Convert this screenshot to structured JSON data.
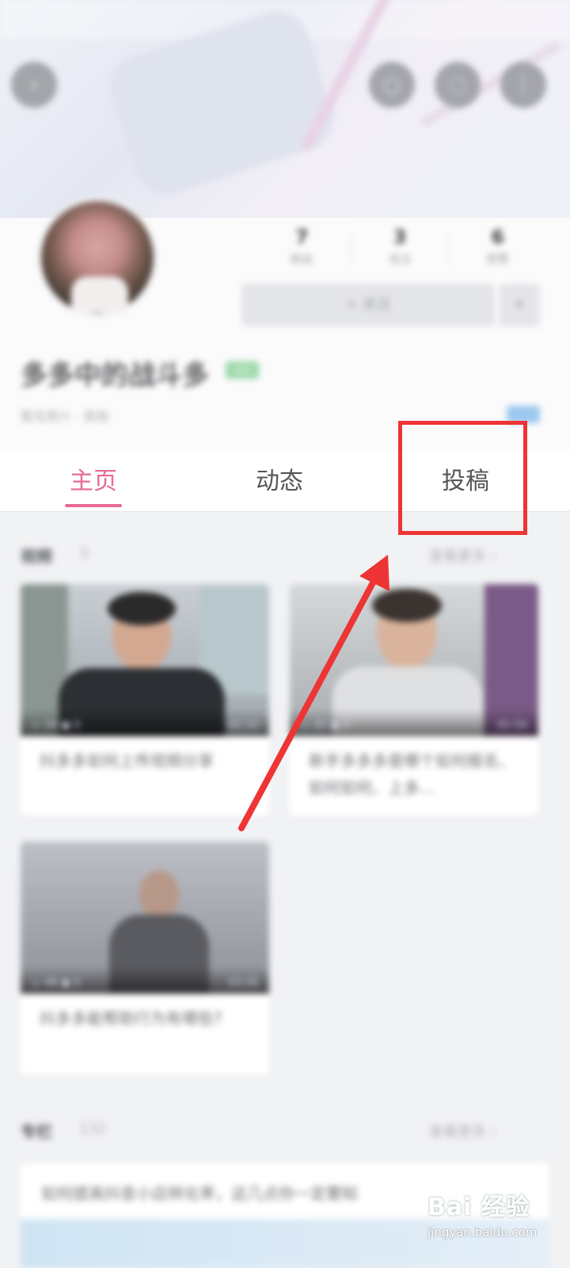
{
  "header": {
    "back_icon": "chevron-left-icon",
    "right_icons": [
      "search-icon",
      "share-icon",
      "more-icon"
    ],
    "glyphs": {
      "back": "‹",
      "search": "○",
      "share": "◌",
      "more": "⋮"
    }
  },
  "profile": {
    "stats": [
      {
        "num": "7",
        "label": "粉丝"
      },
      {
        "num": "3",
        "label": "关注"
      },
      {
        "num": "6",
        "label": "获赞"
      }
    ],
    "follow_label": "+ 关注",
    "more_label": "▾",
    "username": "多多中的战斗多",
    "level_badge": "LV3",
    "sub_info": "暂无简介 · 其他"
  },
  "tabs": [
    {
      "label": "主页",
      "active": true
    },
    {
      "label": "动态",
      "active": false
    },
    {
      "label": "投稿",
      "active": false
    }
  ],
  "videos_section": {
    "title": "视频",
    "count": "3",
    "more": "查看更多 ›"
  },
  "videos": [
    {
      "title": "抖多多如何上传视频分享",
      "views": "▷ 24  ▣ 0",
      "duration": "02:10"
    },
    {
      "title": "新手多多多是哪个如何报名、如何如何、上多…",
      "views": "▷ 32  ▣ 0",
      "duration": "01:54"
    },
    {
      "title": "抖多多能帮助行为有哪些?",
      "views": "▷ 48  ▣ 0",
      "duration": "03:26"
    }
  ],
  "articles_section": {
    "title": "专栏",
    "count": "132",
    "more": "查看更多 ›"
  },
  "article": {
    "title": "如何提高抖音小店转化率，这几点你一定要知"
  },
  "watermark": {
    "brand": "Bai 经验",
    "url": "jingyan.baidu.com"
  },
  "colors": {
    "accent_pink": "#e56a95",
    "annotation_red": "#ee3434"
  }
}
